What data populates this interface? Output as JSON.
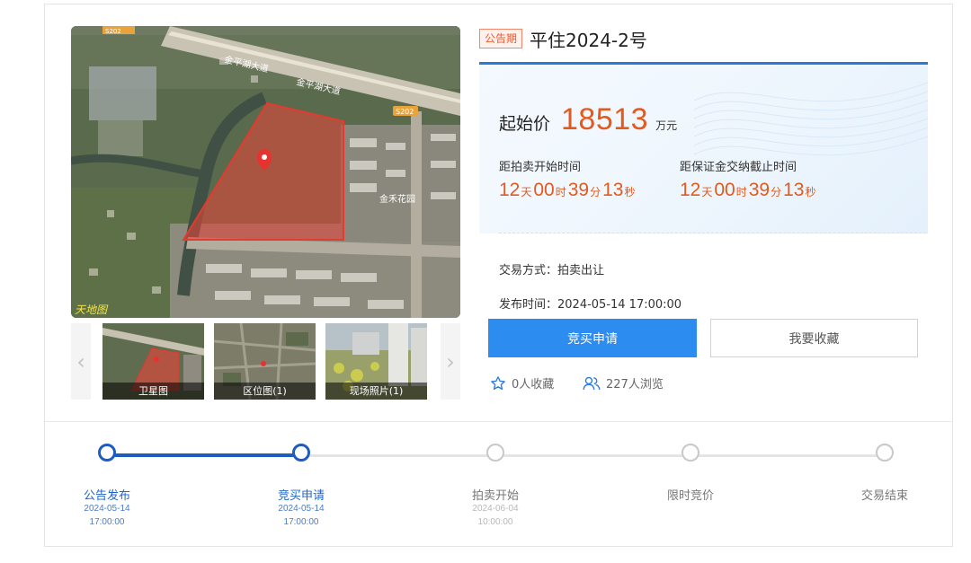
{
  "listing": {
    "status_badge": "公告期",
    "title": "平住2024-2号",
    "price_label": "起始价",
    "price_value": "18513",
    "price_unit": "万元",
    "countdown_auction": {
      "label": "距拍卖开始时间",
      "days": "12",
      "days_unit": "天",
      "hours": "00",
      "hours_unit": "时",
      "minutes": "39",
      "minutes_unit": "分",
      "seconds": "13",
      "seconds_unit": "秒"
    },
    "countdown_deposit": {
      "label": "距保证金交纳截止时间",
      "days": "12",
      "days_unit": "天",
      "hours": "00",
      "hours_unit": "时",
      "minutes": "39",
      "minutes_unit": "分",
      "seconds": "13",
      "seconds_unit": "秒"
    },
    "trade_method": "交易方式：拍卖出让",
    "publish_time": "发布时间：2024-05-14 17:00:00",
    "apply_button": "竞买申请",
    "favorite_button": "我要收藏",
    "favorites_count": "0人收藏",
    "views_count": "227人浏览"
  },
  "map": {
    "road_label_1": "金平湖大道",
    "road_label_2": "金平湖大道",
    "route_badge_1": "S202",
    "route_badge_2": "S202",
    "place_label": "金禾花园",
    "watermark": "天地图",
    "colors": {
      "parcel_fill": "#e0463c",
      "marker": "#e8322d",
      "road": "#c9c3b4"
    }
  },
  "gallery": {
    "thumbs": [
      {
        "caption": "卫星图"
      },
      {
        "caption": "区位图(1)"
      },
      {
        "caption": "现场照片(1)"
      }
    ],
    "prev_arrow": "‹",
    "next_arrow": "›"
  },
  "progress": {
    "completed_steps": 2,
    "steps": [
      {
        "label": "公告发布",
        "date": "2024-05-14",
        "time": "17:00:00",
        "state": "active"
      },
      {
        "label": "竞买申请",
        "date": "2024-05-14",
        "time": "17:00:00",
        "state": "active"
      },
      {
        "label": "拍卖开始",
        "date": "2024-06-04",
        "time": "10:00:00",
        "state": "inactive"
      },
      {
        "label": "限时竞价",
        "date": "",
        "time": "",
        "state": "inactive"
      },
      {
        "label": "交易结束",
        "date": "",
        "time": "",
        "state": "inactive"
      }
    ],
    "colors": {
      "active": "#1e5cbf",
      "inactive": "#c8c8c8"
    }
  }
}
